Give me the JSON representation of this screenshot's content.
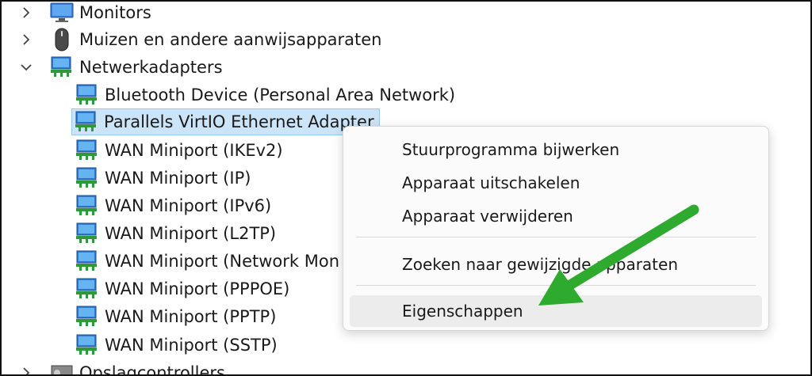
{
  "tree": {
    "categories": [
      {
        "label": "Monitors",
        "icon": "monitor-icon",
        "expanded": false
      },
      {
        "label": "Muizen en andere aanwijsapparaten",
        "icon": "mouse-icon",
        "expanded": false
      },
      {
        "label": "Netwerkadapters",
        "icon": "network-adapter-icon",
        "expanded": true
      },
      {
        "label": "Opslagcontrollers",
        "icon": "storage-controller-icon",
        "expanded": false
      }
    ],
    "devices": [
      {
        "label": "Bluetooth Device (Personal Area Network)"
      },
      {
        "label": "Parallels VirtIO Ethernet Adapter",
        "selected": true
      },
      {
        "label": "WAN Miniport (IKEv2)"
      },
      {
        "label": "WAN Miniport (IP)"
      },
      {
        "label": "WAN Miniport (IPv6)"
      },
      {
        "label": "WAN Miniport (L2TP)"
      },
      {
        "label": "WAN Miniport (Network Mon"
      },
      {
        "label": "WAN Miniport (PPPOE)"
      },
      {
        "label": "WAN Miniport (PPTP)"
      },
      {
        "label": "WAN Miniport (SSTP)"
      }
    ]
  },
  "context_menu": {
    "items": [
      {
        "label": "Stuurprogramma bijwerken"
      },
      {
        "label": "Apparaat uitschakelen"
      },
      {
        "label": "Apparaat verwijderen"
      },
      {
        "label": "Zoeken naar gewijzigde apparaten"
      },
      {
        "label": "Eigenschappen",
        "highlighted": true
      }
    ]
  },
  "annotation": {
    "arrow_color": "#2eaa2e"
  }
}
